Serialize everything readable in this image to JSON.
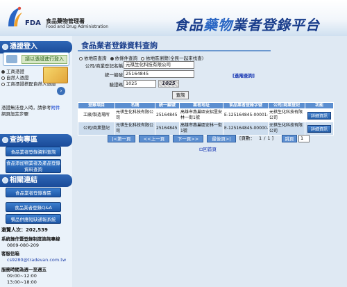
{
  "header": {
    "logo_fda": "FDA",
    "logo_cn": "食品藥物管理署",
    "logo_en": "Food and Drug Administration",
    "site_title_1": "食品",
    "site_title_2": "藥物",
    "site_title_3": "業者登錄平台"
  },
  "sidebar": {
    "login_heading": "憑證登入",
    "login_button": "請以憑證進行登入",
    "login_types": [
      "工商憑證",
      "自然人憑證",
      "工商憑證搭配自然人憑證"
    ],
    "login_note": "憑證無法登入時，請參考",
    "login_note_link": "附件",
    "login_note_tail": "網頁設定步驟",
    "query_heading": "查詢專區",
    "query_items": [
      "食品業者登錄資料查詢",
      "食品添加物業者及產品登錄資料查詢"
    ],
    "links_heading": "相關連結",
    "link_items": [
      "食品業者登錄專區",
      "食品業者登錄Q&A",
      "餐品供應短缺通報系統"
    ],
    "visitors_label": "瀏覽人次：",
    "visitors_count": "202,539",
    "hotline_label": "系統操作暨登錄制度諮詢專線",
    "hotline_number": "0809-080-209",
    "mail_label": "客服信箱",
    "mail_address": "cs9280@tradevan.com.tw",
    "hours_label": "服務時間為週一至週五",
    "hours_am": "09:00~12:00",
    "hours_pm": "13:00~18:00"
  },
  "form": {
    "title": "食品業者登錄資料查詢",
    "modes": [
      "依地區查詢",
      "依條件查詢",
      "依地區瀏覽(全民一起來找查)"
    ],
    "selected_mode": 1,
    "company_label": "公司/商業登記名稱",
    "company_value": "元祺生化科技有限公司",
    "taxid_label": "統一編號",
    "taxid_value": "25164845",
    "captcha_label": "驗證碼",
    "captcha_value": "1025",
    "captcha_image_text": "1025",
    "advanced_link": "[進階查詢]",
    "search_button": "查詢"
  },
  "table": {
    "columns": [
      "登錄項目",
      "名稱",
      "統一編號",
      "業者地址",
      "食品業者登錄字號",
      "公司/商業登記",
      "功能"
    ],
    "rows": [
      [
        "工廠/製造場所",
        "元祺生化科技有限公司",
        "25164845",
        "高雄市燕巢區安招里安林一街1號",
        "E-125164845-00001-8",
        "元祺生化科技有限公司",
        "詳細資訊"
      ],
      [
        "公司/商業登記",
        "元祺生化科技有限公司",
        "25164845",
        "高雄市燕巢區安林一街1號",
        "E-125164845-00000-7",
        "元祺生化科技有限公司",
        "詳細資訊"
      ]
    ]
  },
  "pager": {
    "first": "|<第一頁",
    "prev": "<<上一頁",
    "next": "下一頁>>",
    "last": "最後頁>|",
    "page_prefix": "[頁數：",
    "page_current": "1",
    "page_sep": "/",
    "page_total": "1",
    "page_suffix": "]",
    "jump_label": "跳頁",
    "jump_value": "1"
  },
  "home_link": "回首頁",
  "colors": {
    "brand": "#1a3e8c",
    "header_bar": "#5b8ed0",
    "row_alt": "#cdddee",
    "page_bg": "#dfe9f3"
  }
}
